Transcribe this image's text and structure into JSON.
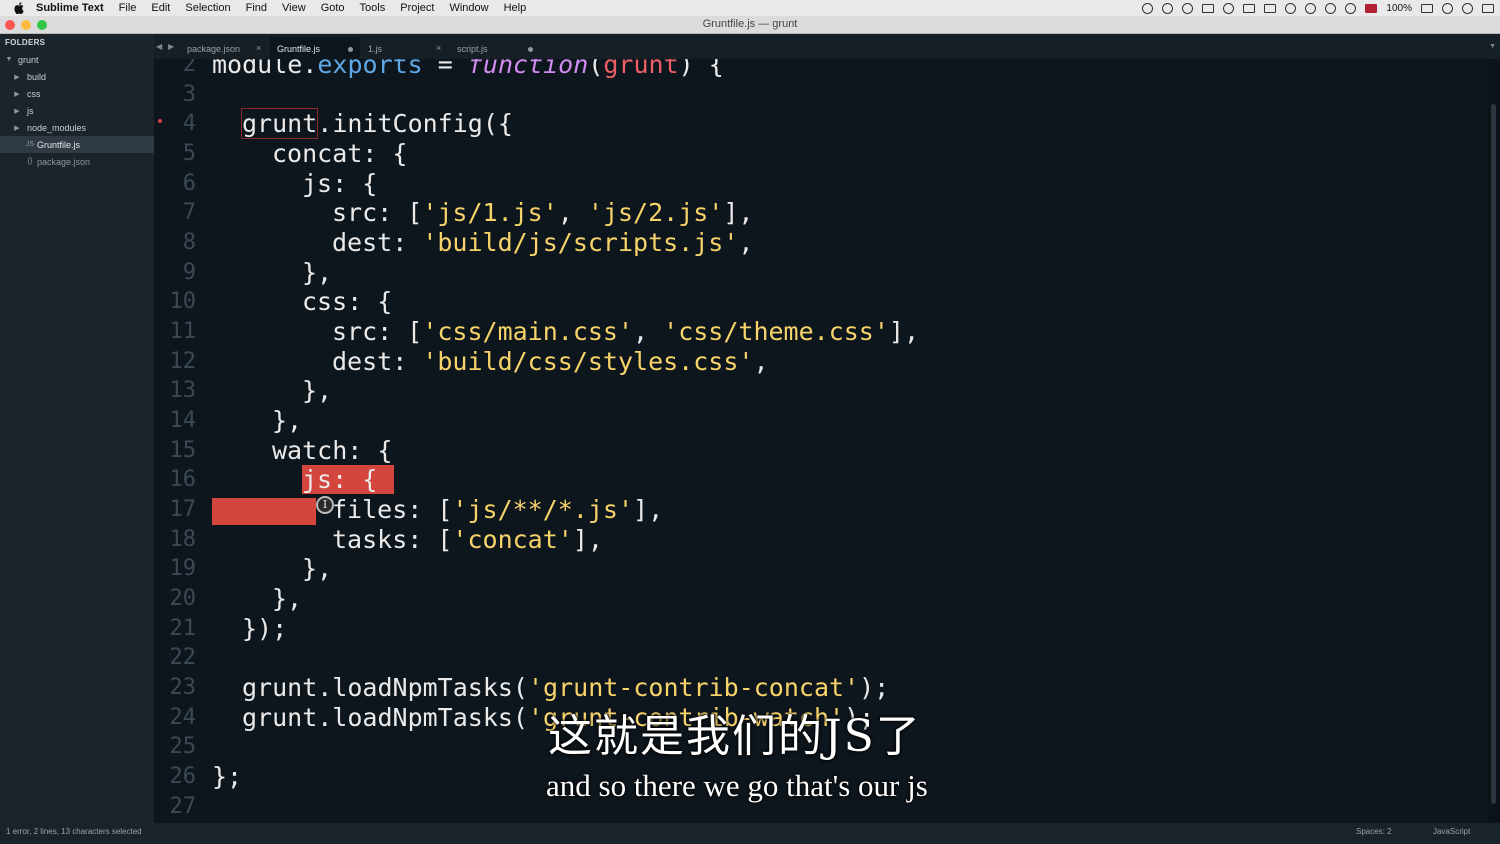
{
  "menubar": {
    "app_name": "Sublime Text",
    "items": [
      "File",
      "Edit",
      "Selection",
      "Find",
      "View",
      "Goto",
      "Tools",
      "Project",
      "Window",
      "Help"
    ],
    "battery": "100%"
  },
  "window": {
    "title": "Gruntfile.js — grunt"
  },
  "sidebar": {
    "header": "FOLDERS",
    "items": [
      {
        "label": "grunt",
        "type": "folder-open"
      },
      {
        "label": "build",
        "type": "folder"
      },
      {
        "label": "css",
        "type": "folder"
      },
      {
        "label": "js",
        "type": "folder"
      },
      {
        "label": "node_modules",
        "type": "folder"
      },
      {
        "label": "Gruntfile.js",
        "type": "file-js",
        "selected": true
      },
      {
        "label": "package.json",
        "type": "file-json"
      }
    ]
  },
  "tabs": [
    {
      "label": "package.json",
      "state": "close"
    },
    {
      "label": "Gruntfile.js",
      "state": "dirty",
      "active": true
    },
    {
      "label": "1.js",
      "state": "close"
    },
    {
      "label": "script.js",
      "state": "dirty"
    }
  ],
  "editor": {
    "line_numbers": [
      "2",
      "3",
      "4",
      "5",
      "6",
      "7",
      "8",
      "9",
      "10",
      "11",
      "12",
      "13",
      "14",
      "15",
      "16",
      "17",
      "18",
      "19",
      "20",
      "21",
      "22",
      "23",
      "24",
      "25",
      "26",
      "27"
    ],
    "lines": {
      "l2": {
        "a": "module.",
        "b": "exports",
        "c": " = ",
        "d": "function",
        "e": "(",
        "f": "grunt",
        "g": ") {"
      },
      "l4": {
        "a": "grunt",
        "b": ".initConfig({"
      },
      "l5": "concat: {",
      "l6": "js: {",
      "l7": {
        "a": "src: [",
        "b": "'js/1.js'",
        "c": ", ",
        "d": "'js/2.js'",
        "e": "],"
      },
      "l8": {
        "a": "dest: ",
        "b": "'build/js/scripts.js'",
        "c": ","
      },
      "l9": "},",
      "l10": "css: {",
      "l11": {
        "a": "src: [",
        "b": "'css/main.css'",
        "c": ", ",
        "d": "'css/theme.css'",
        "e": "],"
      },
      "l12": {
        "a": "dest: ",
        "b": "'build/css/styles.css'",
        "c": ","
      },
      "l13": "},",
      "l14": "},",
      "l15": "watch: {",
      "l16": "js: {",
      "l17": {
        "a": "files: [",
        "b": "'js/**/*.js'",
        "c": "],"
      },
      "l18": {
        "a": "tasks: [",
        "b": "'concat'",
        "c": "],"
      },
      "l19": "},",
      "l20": "},",
      "l21": "});",
      "l23": {
        "a": "grunt.loadNpmTasks(",
        "b": "'grunt-contrib-concat'",
        "c": ");"
      },
      "l24": {
        "a": "grunt.loadNpmTasks(",
        "b": "'grunt-contrib-watch'",
        "c": ");"
      },
      "l26": "};"
    }
  },
  "statusbar": {
    "left": "1 error, 2 lines, 13 characters selected",
    "spaces": "Spaces: 2",
    "syntax": "JavaScript"
  },
  "subtitles": {
    "zh": "这就是我们的JS了",
    "en": "and so there we go that's our js"
  },
  "colors": {
    "selection": "#d4453e",
    "string": "#f7d36a",
    "background": "#0e161d"
  }
}
